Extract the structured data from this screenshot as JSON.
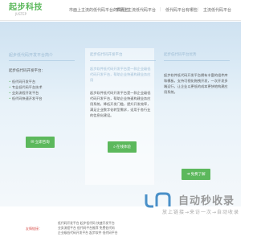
{
  "header": {
    "logo_main": "起步科技",
    "logo_sub": "JUSTEP",
    "nav": [
      "市面上主流的低代码平台的局限性",
      "市场上主流低代码平台",
      "低代码平台有哪些",
      "主流低代码平台"
    ]
  },
  "columns": [
    {
      "title": "起步低代码开发平台简介",
      "intro": "起步低代码开发平台：",
      "bullets": [
        "低代码开发平台",
        "专业低代码平台技术",
        "业务流程开发平台",
        "低代码快速开发平台"
      ],
      "button": "立即咨询"
    },
    {
      "title": "起步低代码开发平台",
      "text": "起步软件低代码开发平台是一款企业级低代码开发平台，帮助企业快速构建业务应用系统，降低开发门槛，提升开发效率，满足企业数字化转型需求，适用于各行业的信息化建设。",
      "button": "在线体验"
    },
    {
      "title": "起步低代码平台优势",
      "text": "起步软件低代码开发平台拥有丰富的组件库和模板，支持可视化拖拽开发，一次开发多端运行，让企业以更低的成本更快地构建应用系统。",
      "button": "免费了解"
    }
  ],
  "watermark": {
    "text": "自动秒收录",
    "sub": "放上链接→来访一次→自动收录"
  },
  "footer": {
    "friend_label": "友情链接：",
    "links": [
      "低代码开发平台 起步低代码 快速开发平台",
      "业务流程平台 低代码平台推荐 免费低代码",
      "企业级低代码开发平台 起步软件 低代码平台"
    ]
  },
  "colors": {
    "brand_green": "#5cb85c",
    "hero_top": "#cfe2f1",
    "hero_bottom": "#f4f8fb",
    "friend_red": "#d9534f"
  }
}
